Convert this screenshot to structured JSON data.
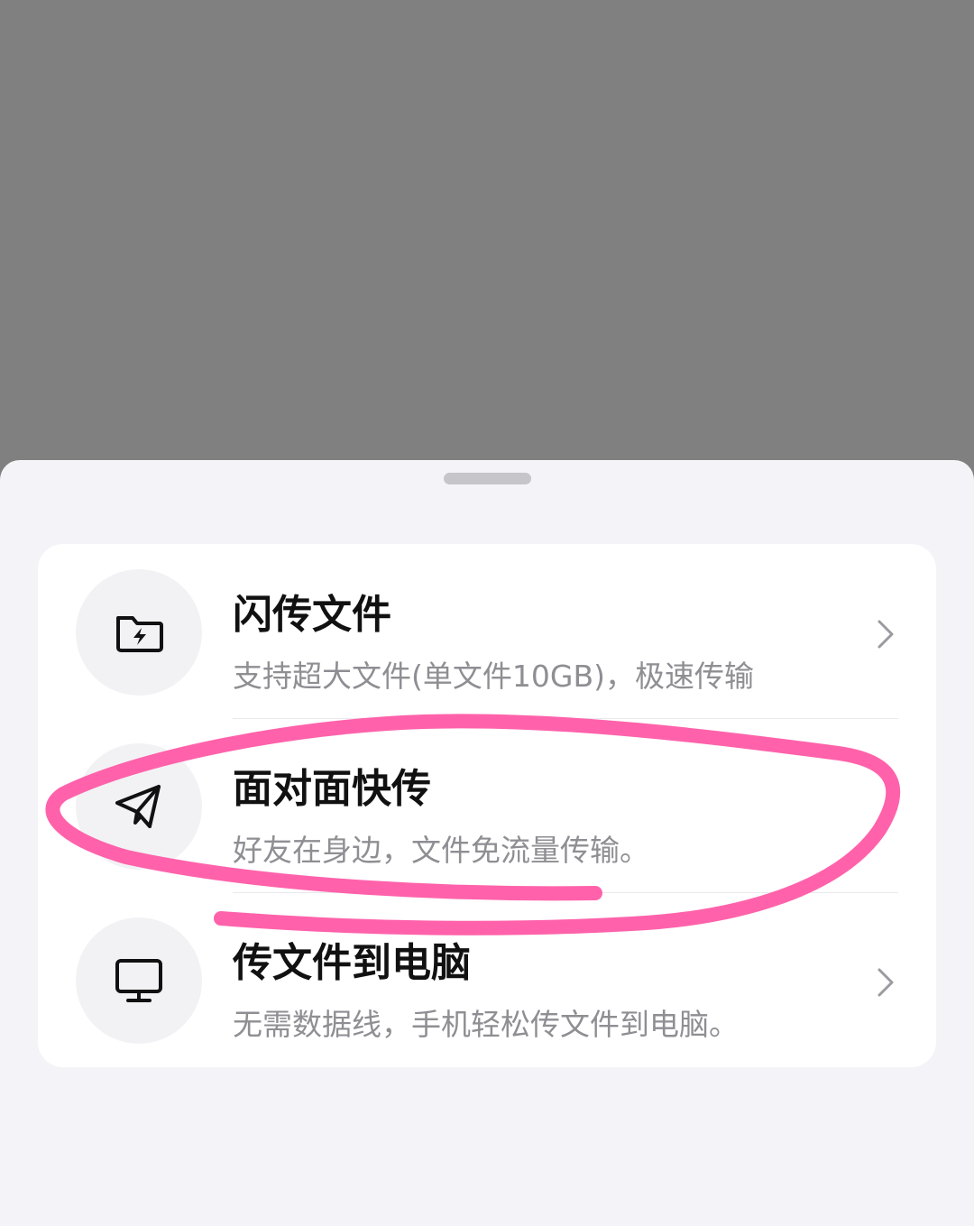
{
  "menu": {
    "items": [
      {
        "title": "闪传文件",
        "subtitle": "支持超大文件(单文件10GB)，极速传输",
        "icon": "folder-lightning-icon",
        "has_chevron": true
      },
      {
        "title": "面对面快传",
        "subtitle": "好友在身边，文件免流量传输。",
        "icon": "paper-plane-icon",
        "has_chevron": false
      },
      {
        "title": "传文件到电脑",
        "subtitle": "无需数据线，手机轻松传文件到电脑。",
        "icon": "monitor-icon",
        "has_chevron": true
      }
    ]
  },
  "colors": {
    "backdrop": "#808080",
    "sheet": "#f4f4f8",
    "card": "#ffffff",
    "annotation": "#ff5aa5"
  }
}
